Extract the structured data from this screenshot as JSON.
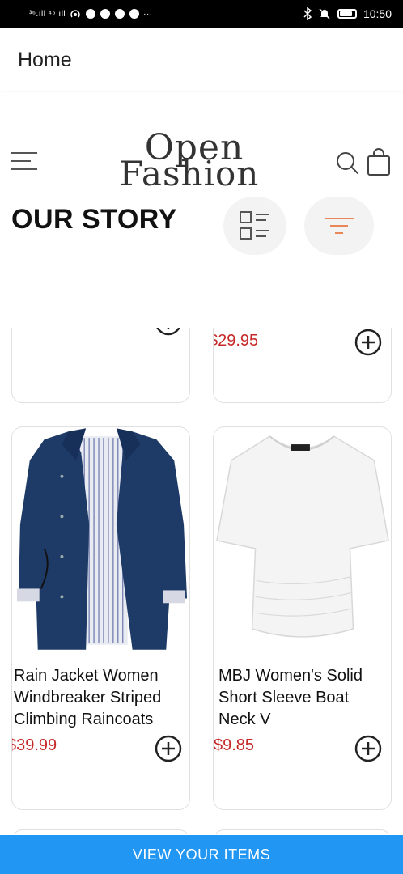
{
  "status_bar": {
    "left_indicators": "³⁶.ıll ⁴⁶.ıll",
    "time": "10:50"
  },
  "app_bar": {
    "title": "Home"
  },
  "header": {
    "logo_line1": "Open",
    "logo_line2": "Fashion",
    "section_title": "OUR STORY"
  },
  "icons": {
    "menu": "menu-icon",
    "search": "search-icon",
    "bag": "shopping-bag-icon",
    "list_view": "list-view-icon",
    "filter": "filter-icon",
    "add": "add-circle-icon"
  },
  "colors": {
    "price": "#c62828",
    "cta": "#2196f3",
    "filter_accent": "#e8875a"
  },
  "products": [
    {
      "title": "",
      "price": ""
    },
    {
      "title": "",
      "price": "$29.95"
    },
    {
      "title": "Rain Jacket Women Windbreaker Striped Climbing Raincoats",
      "price": "$39.99"
    },
    {
      "title": "MBJ Women's Solid Short Sleeve Boat Neck V",
      "price": "$9.85"
    }
  ],
  "cta": {
    "label": "VIEW YOUR ITEMS"
  }
}
